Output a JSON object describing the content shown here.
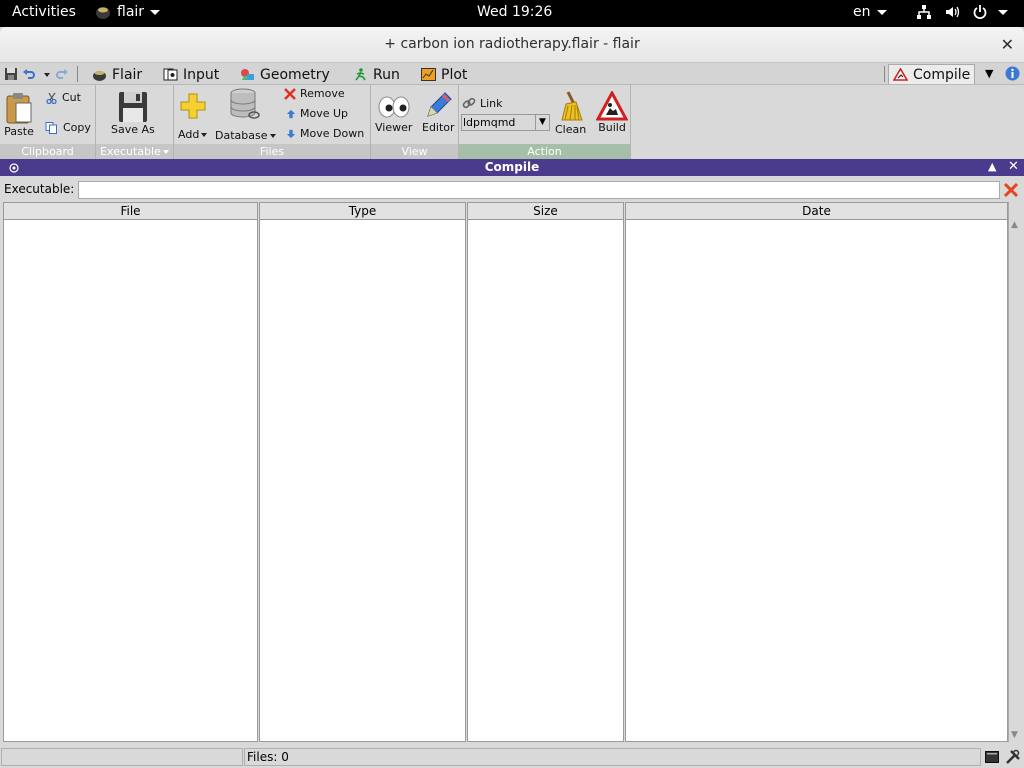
{
  "system": {
    "activities": "Activities",
    "app_name": "flair",
    "clock": "Wed 19:26",
    "language": "en"
  },
  "window": {
    "title": "+ carbon ion radiotherapy.flair - flair"
  },
  "tabs": {
    "flair": "Flair",
    "input": "Input",
    "geometry": "Geometry",
    "run": "Run",
    "plot": "Plot",
    "compile": "Compile"
  },
  "ribbon": {
    "clipboard": {
      "paste": "Paste",
      "cut": "Cut",
      "copy": "Copy",
      "label": "Clipboard"
    },
    "executable": {
      "save_as": "Save As",
      "label": "Executable"
    },
    "files": {
      "add": "Add",
      "database": "Database",
      "remove": "Remove",
      "move_up": "Move Up",
      "move_down": "Move Down",
      "label": "Files"
    },
    "view": {
      "viewer": "Viewer",
      "editor": "Editor",
      "label": "View"
    },
    "action": {
      "link": "Link",
      "link_value": "ldpmqmd",
      "clean": "Clean",
      "build": "Build",
      "label": "Action"
    }
  },
  "panel": {
    "title": "Compile",
    "executable_label": "Executable:",
    "executable_value": ""
  },
  "table": {
    "columns": [
      "File",
      "Type",
      "Size",
      "Date"
    ],
    "rows": []
  },
  "status": {
    "files": "Files: 0"
  },
  "colors": {
    "panel_header": "#4a3b8c",
    "action_group": "#a6bfa8",
    "clear_button": "#e8431c"
  }
}
